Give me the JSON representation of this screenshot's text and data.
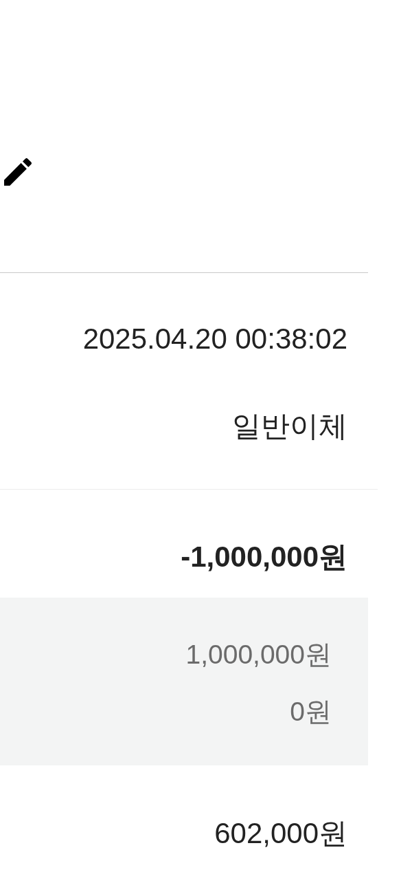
{
  "transaction": {
    "datetime": "2025.04.20 00:38:02",
    "type": "일반이체"
  },
  "amount": {
    "total": "-1,000,000원",
    "breakdown": [
      "1,000,000원",
      "0원"
    ]
  },
  "balance": "602,000원"
}
